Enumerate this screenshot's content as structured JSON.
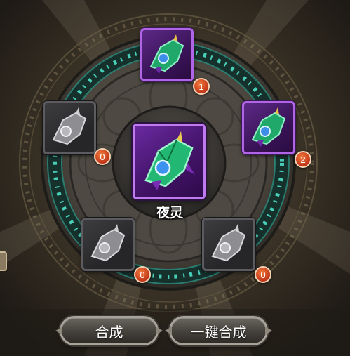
{
  "center": {
    "item_name": "夜灵"
  },
  "slots": [
    {
      "id": "top",
      "count": "1",
      "style": "purple"
    },
    {
      "id": "right",
      "count": "2",
      "style": "purple"
    },
    {
      "id": "left",
      "count": "0",
      "style": "gray"
    },
    {
      "id": "bottom-left",
      "count": "0",
      "style": "gray"
    },
    {
      "id": "bottom-right",
      "count": "0",
      "style": "gray"
    }
  ],
  "buttons": {
    "synthesize_label": "合成",
    "one_click_synthesize_label": "一键合成"
  },
  "colors": {
    "rare_border": "#b064e6",
    "rune_glow": "#4fe0c8",
    "badge": "#d24a22",
    "background": "#2e2820"
  },
  "icons": {
    "item": "green-horned-gem-icon",
    "item_placeholder": "gray-horned-gem-icon"
  }
}
